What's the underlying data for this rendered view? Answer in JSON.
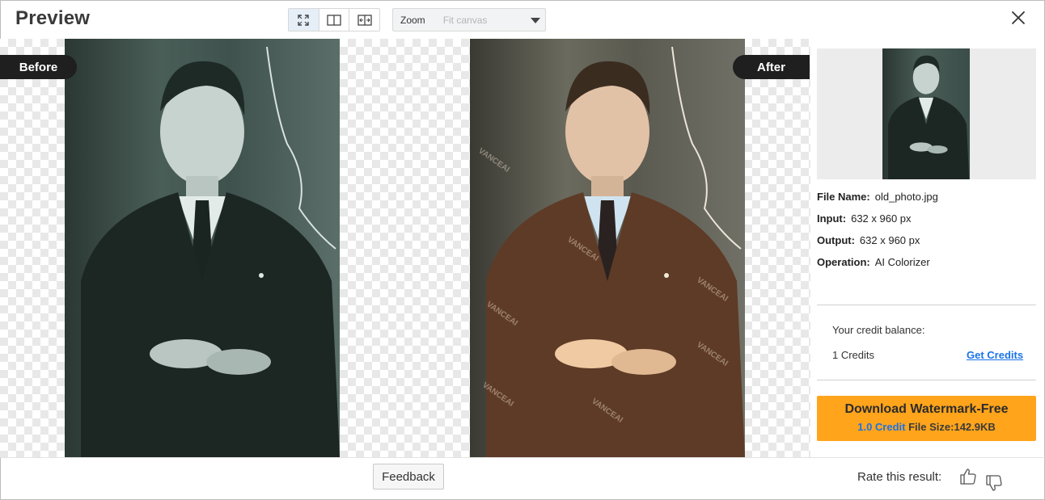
{
  "header": {
    "title": "Preview",
    "view_modes": [
      "fit-view-icon",
      "split-view-icon",
      "compare-slider-icon"
    ],
    "zoom_label": "Zoom",
    "zoom_value": "Fit canvas"
  },
  "labels": {
    "before": "Before",
    "after": "After"
  },
  "watermark": "VANCEAI",
  "file_info": {
    "file_name_label": "File Name:",
    "file_name": "old_photo.jpg",
    "input_label": "Input:",
    "input_value": "632 x 960 px",
    "output_label": "Output:",
    "output_value": "632 x 960 px",
    "operation_label": "Operation:",
    "operation_value": "AI Colorizer"
  },
  "credits": {
    "balance_label": "Your credit balance:",
    "balance_value": "1 Credits",
    "get_credits": "Get Credits"
  },
  "download": {
    "title": "Download Watermark-Free",
    "credit": "1.0 Credit",
    "file_size": "File Size:142.9KB"
  },
  "footer": {
    "feedback": "Feedback",
    "rate_label": "Rate this result:"
  },
  "colors": {
    "accent": "#ffa41b",
    "link": "#1a73e8",
    "pill": "#1f1f1f"
  }
}
